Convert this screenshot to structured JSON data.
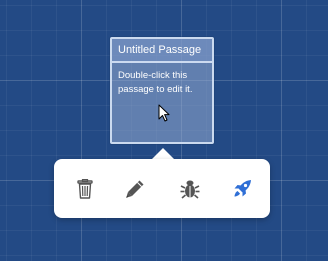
{
  "passage": {
    "title": "Untitled Passage",
    "excerpt": "Double-click this passage to edit it."
  },
  "toolbar": {
    "tools": [
      {
        "name": "delete",
        "icon": "trash-icon",
        "color": "#555555"
      },
      {
        "name": "edit",
        "icon": "pencil-icon",
        "color": "#555555"
      },
      {
        "name": "test",
        "icon": "bug-icon",
        "color": "#555555"
      },
      {
        "name": "play",
        "icon": "rocket-icon",
        "color": "#2f6fd6"
      }
    ]
  },
  "colors": {
    "background": "#234a85",
    "toolbar_background": "#ffffff",
    "accent": "#2f6fd6",
    "icon": "#555555"
  }
}
